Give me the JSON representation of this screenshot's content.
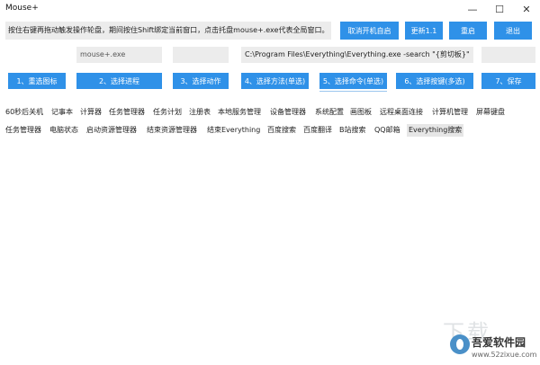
{
  "window": {
    "title": "Mouse+",
    "minimize_glyph": "—",
    "maximize_glyph": "☐",
    "close_glyph": "✕"
  },
  "header": {
    "instruction": "按住右键再拖动触发操作轮盘，期间按住Shift绑定当前窗口，点击托盘mouse+.exe代表全局窗口。",
    "buttons": {
      "cancel_autostart": "取消开机自启",
      "update": "更新1.1",
      "restart": "重启",
      "exit": "退出"
    }
  },
  "fields": {
    "process_placeholder": "mouse+.exe",
    "field2_value": "",
    "command_value": "C:\\Program Files\\Everything\\Everything.exe -search \"{剪切板}\"",
    "field4_value": ""
  },
  "steps": [
    "1、重选图标",
    "2、选择进程",
    "3、选择动作",
    "4、选择方法(单选)",
    "5、选择命令(单选)",
    "6、选择按键(多选)",
    "7、保存"
  ],
  "commands_row1": [
    "60秒后关机",
    "记事本",
    "计算器",
    "任务管理器",
    "任务计划",
    "注册表",
    "本地服务管理",
    "设备管理器",
    "系统配置",
    "画图板",
    "远程桌面连接",
    "计算机管理",
    "屏幕键盘"
  ],
  "commands_row2": [
    "任务管理器",
    "电脑状态",
    "启动资源管理器",
    "结束资源管理器",
    "结束Everything",
    "百度搜索",
    "百度翻译",
    "B站搜索",
    "QQ邮箱",
    "Everything搜索"
  ],
  "watermark": {
    "big_text": "下载",
    "site_name": "吾爱软件园",
    "url": "www.52zixue.com"
  }
}
